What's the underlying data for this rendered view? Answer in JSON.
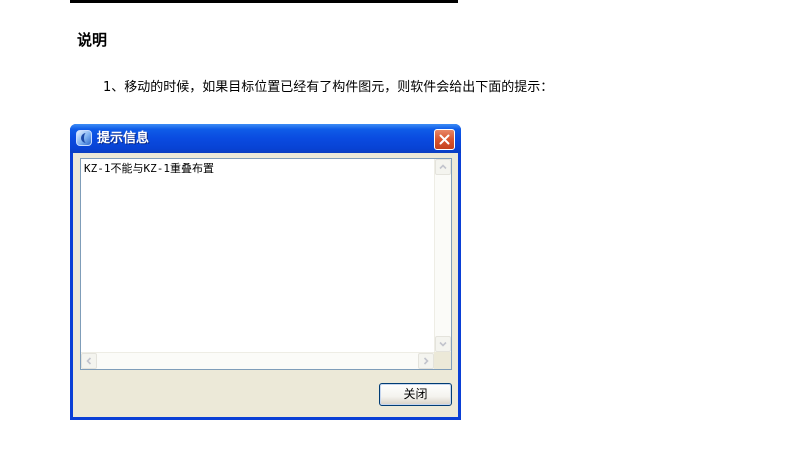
{
  "document": {
    "heading": "说明",
    "paragraph": "1、移动的时候，如果目标位置已经有了构件图元，则软件会给出下面的提示："
  },
  "dialog": {
    "title": "提示信息",
    "message": "KZ-1不能与KZ-1重叠布置",
    "close_button_label": "关闭"
  },
  "colors": {
    "titlebar": "#0a4be0",
    "close_button": "#d9552f",
    "client_background": "#ece9d8",
    "textbox_border": "#7f9db9"
  },
  "icons": [
    "app-icon",
    "close-icon",
    "arrow-up-icon",
    "arrow-down-icon",
    "arrow-left-icon",
    "arrow-right-icon"
  ]
}
